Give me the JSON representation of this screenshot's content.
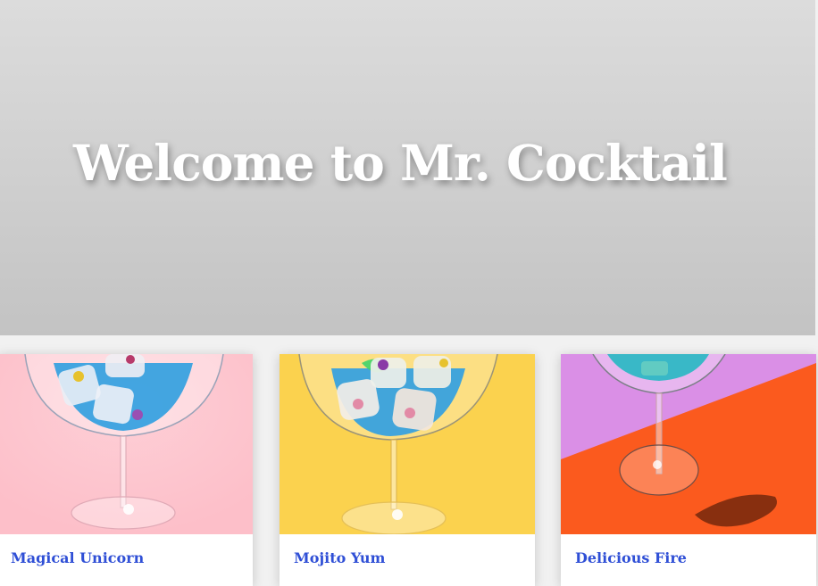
{
  "hero": {
    "title": "Welcome to Mr. Cocktail"
  },
  "cards": [
    {
      "name": "Magical Unicorn",
      "background": "#fdbfc9",
      "liquid": "#2f9fe0"
    },
    {
      "name": "Mojito Yum",
      "background": "#fbd24e",
      "liquid": "#2d9ee3"
    },
    {
      "name": "Delicious Fire",
      "background": "#fb5a1e",
      "accent": "#da8fe6",
      "liquid": "#2fb8c4"
    }
  ]
}
